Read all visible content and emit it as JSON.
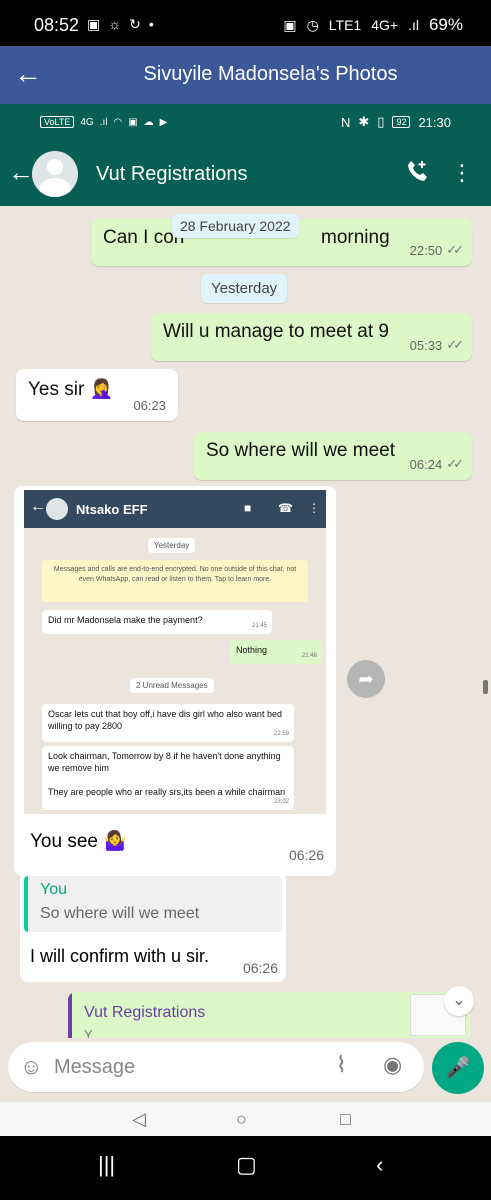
{
  "system_status": {
    "time": "08:52",
    "battery": "69%",
    "network": "4G+",
    "lte": "LTE1"
  },
  "facebook_header": {
    "back": "←",
    "title": "Sivuyile Madonsela's Photos"
  },
  "whatsapp_status": {
    "left_text": "VoLTE",
    "network": "4G",
    "battery_level": "92",
    "time": "21:30"
  },
  "chat_header": {
    "back": "←",
    "contact_name": "Vut Registrations",
    "call_icon": "add-call-icon",
    "menu_icon": "more-vert-icon"
  },
  "date_chips": {
    "first": "28 February 2022",
    "second": "Yesterday"
  },
  "messages": {
    "confirm_text": "Can I con",
    "confirm_tail": "morning",
    "confirm_time": "22:50",
    "manage_text": "Will u manage to meet at 9",
    "manage_time": "05:33",
    "yes_sir_text": "Yes sir",
    "yes_sir_emoji": "🤦‍♀️",
    "yes_sir_time": "06:23",
    "where_text": "So where will we meet",
    "where_time": "06:24",
    "image_caption": "You see",
    "image_caption_emoji": "🤷‍♀️",
    "image_time": "06:26",
    "reply_author": "You",
    "reply_quote": "So where will we meet",
    "reply_body": "I will confirm with u sir.",
    "reply_time": "06:26",
    "partial_title": "Vut Registrations",
    "partial_sub": "Y"
  },
  "embedded_screenshot": {
    "contact_name": "Ntsako EFF",
    "day_label": "Yesterday",
    "encryption_notice": "Messages and calls are end-to-end encrypted. No one outside of this chat, not even WhatsApp, can read or listen to them. Tap to learn more.",
    "message_1": "Did mr Madonsela make the payment?",
    "message_1_time": "21:45",
    "reply_1": "Nothing",
    "reply_1_time": "21:48",
    "unread_label": "2 Unread Messages",
    "message_2": "Oscar lets cut that boy off,i have dis girl who also want bed willing to pay 2800",
    "message_2_time": "22:59",
    "message_3": "Look chairman, Tomorrow by 8 if he haven't done anything we remove him",
    "message_4": "They are people who ar really srs,its been a while chairman",
    "message_4_time": "23:02"
  },
  "composer": {
    "placeholder": "Message",
    "emoji_icon": "emoji-icon",
    "attach_icon": "paperclip-icon",
    "camera_icon": "camera-icon",
    "mic_icon": "microphone-icon"
  },
  "colors": {
    "facebook_blue": "#3b5998",
    "whatsapp_green": "#075e54",
    "outgoing_bubble": "#dcf8c6",
    "chat_background": "#ece5dd"
  }
}
